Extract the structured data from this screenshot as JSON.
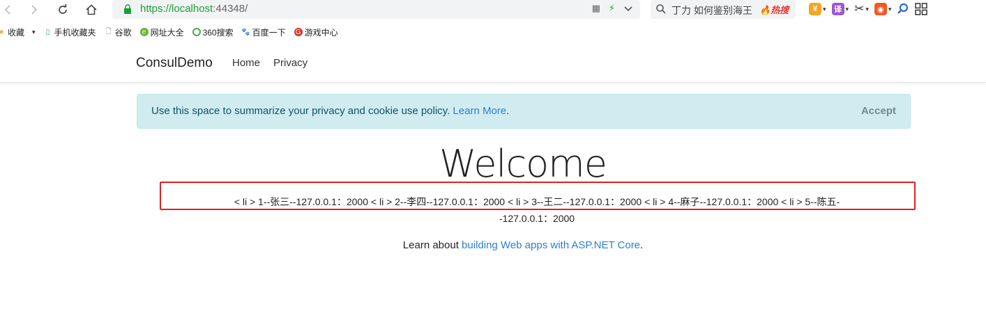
{
  "browser": {
    "url_scheme_host": "https://localhost",
    "url_rest": ":44348/",
    "search_text": "丁力 如何鉴别海王",
    "hot_badge": "🔥热搜"
  },
  "bookmarks": [
    {
      "icon": "star-icon",
      "label": "收藏"
    },
    {
      "icon": "phone-icon",
      "label": "手机收藏夹"
    },
    {
      "icon": "page-icon",
      "label": "谷歌"
    },
    {
      "icon": "globe-icon",
      "label": "网址大全"
    },
    {
      "icon": "360-icon",
      "label": "360搜索"
    },
    {
      "icon": "paw-icon",
      "label": "百度一下"
    },
    {
      "icon": "game-icon",
      "label": "游戏中心"
    }
  ],
  "site": {
    "brand": "ConsulDemo",
    "nav": [
      "Home",
      "Privacy"
    ]
  },
  "cookie": {
    "text": "Use this space to summarize your privacy and cookie use policy.",
    "link": "Learn More",
    "period": ".",
    "accept": "Accept"
  },
  "main": {
    "welcome": "Welcome",
    "list_line1": "< li > 1--张三--127.0.0.1：2000 < li > 2--李四--127.0.0.1：2000 < li > 3--王二--127.0.0.1：2000 < li > 4--麻子--127.0.0.1：2000 < li > 5--陈五-",
    "list_line2": "-127.0.0.1：2000",
    "learn_prefix": "Learn about ",
    "learn_link": "building Web apps with ASP.NET Core",
    "learn_suffix": "."
  },
  "colors": {
    "alert_bg": "#d1ecf1",
    "link": "#2b7ed0",
    "highlight": "#e0201e",
    "url_green": "#1a9e3a"
  }
}
